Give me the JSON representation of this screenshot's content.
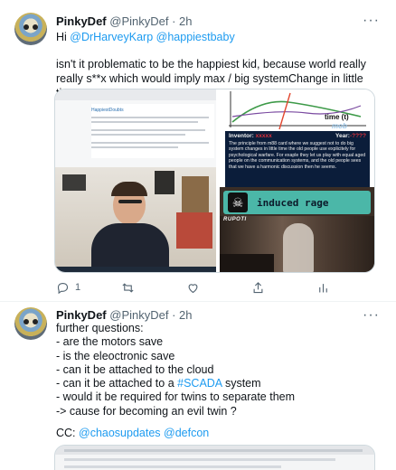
{
  "tweet1": {
    "name": "PinkyDef",
    "handle": "@PinkyDef",
    "time": "· 2h",
    "reply_prefix": "Hi ",
    "mention1": "@DrHarveyKarp",
    "mention2": "@happiestbaby",
    "body": "isn't it problematic to be the happiest kid, because world really really s**x which would imply max / big systemChange in little time ???",
    "media": {
      "doc_title": "HappiestDoubts",
      "graph_label": "time (t)",
      "panel_logo": "mob",
      "inventor_label": "Inventor:",
      "inventor_value": "xxxxx",
      "year_label": "Year:",
      "year_value": "-????",
      "panel_text": "The principle from m88 card where we suggest not to do big system changes in little time the old people use explicitely for psychological warfare. For exaple they let us play with equal aged people on the communication systems, and the old people sees that we have a harmonic discussion then he seems.",
      "rage_label": "induced rage",
      "rage_sub": "RUPOTI"
    },
    "actions": {
      "reply_count": "1",
      "retweet_count": "",
      "like_count": ""
    }
  },
  "tweet2": {
    "name": "PinkyDef",
    "handle": "@PinkyDef",
    "time": "· 2h",
    "lines": [
      "further questions:",
      "- are the motors save",
      "- is the eleoctronic save",
      "- can it be attached to the cloud"
    ],
    "scada_prefix": "- can it be attached to a ",
    "scada_tag": "#SCADA",
    "scada_suffix": " system",
    "lines2": [
      "- would it be required for twins to separate them",
      "-> cause for becoming an evil twin ?"
    ],
    "cc_label": "CC: ",
    "cc_mention1": "@chaosupdates",
    "cc_mention2": "@defcon"
  },
  "colors": {
    "link": "#1d9bf0",
    "muted": "#536471",
    "text": "#0f1419"
  },
  "icons": [
    "reply-icon",
    "retweet-icon",
    "like-icon",
    "share-icon",
    "analytics-icon",
    "more-icon"
  ]
}
